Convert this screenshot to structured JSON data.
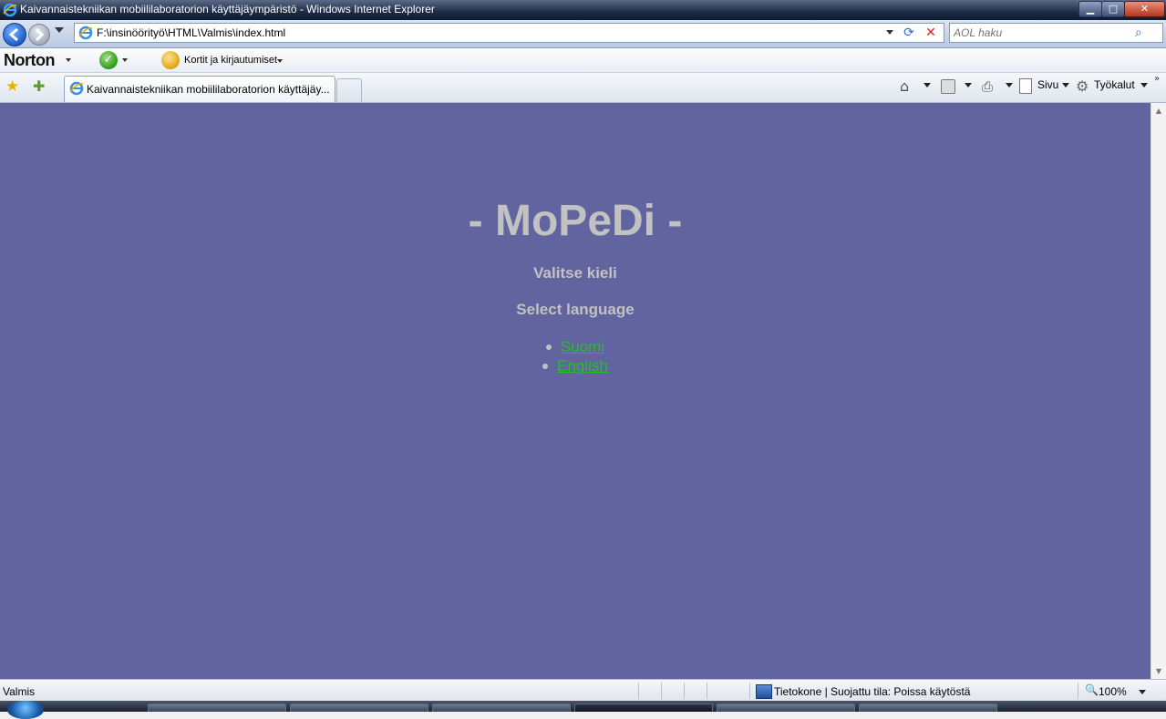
{
  "window": {
    "title": "Kaivannaistekniikan mobiililaboratorion käyttäjäympäristö - Windows Internet Explorer",
    "min_glyph": "▁",
    "max_glyph": "□",
    "close_glyph": "✕"
  },
  "address_bar": {
    "url": "F:\\insinöörityö\\HTML\\Valmis\\index.html",
    "refresh_glyph": "⟳",
    "stop_glyph": "✕"
  },
  "search": {
    "placeholder": "AOL haku",
    "icon_glyph": "⌕"
  },
  "norton_bar": {
    "logo": "Norton",
    "safe_glyph": "✓",
    "identity_safe_label": "Kortit ja kirjautumiset"
  },
  "tabs": {
    "active_label": "Kaivannaistekniikan mobiililaboratorion käyttäjäy...",
    "fav_glyph": "★",
    "add_fav_glyph": "✚"
  },
  "command_bar": {
    "home_glyph": "⌂",
    "print_glyph": "⎙",
    "page_label": "Sivu",
    "tools_glyph": "⚙",
    "tools_label": "Työkalut",
    "chevron_glyph": "»"
  },
  "page": {
    "heading": "- MoPeDi -",
    "subtitle_fi": "Valitse kieli",
    "subtitle_en": "Select language",
    "languages": [
      {
        "label": "Suomi"
      },
      {
        "label": "English"
      }
    ],
    "background_color": "#6264a0",
    "text_color": "#c2c2c2",
    "link_color": "#1ec31e"
  },
  "scrollbar": {
    "up_glyph": "▲",
    "down_glyph": "▼"
  },
  "status_bar": {
    "status": "Valmis",
    "zone": "Tietokone | Suojattu tila: Poissa käytöstä",
    "zoom": "100%",
    "zoom_glyph": "🔍"
  }
}
